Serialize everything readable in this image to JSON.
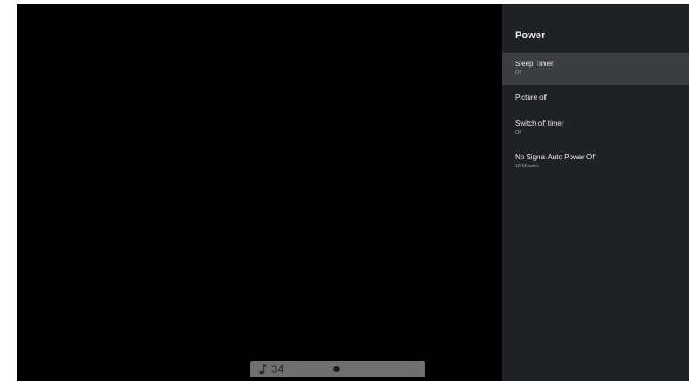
{
  "panel": {
    "title": "Power",
    "items": [
      {
        "label": "Sleep Timer",
        "value": "Off",
        "selected": true
      },
      {
        "label": "Picture off",
        "value": ""
      },
      {
        "label": "Switch off timer",
        "value": "Off"
      },
      {
        "label": "No Signal Auto Power Off",
        "value": "15 Minutes"
      }
    ]
  },
  "volume": {
    "value": "34",
    "level": 0.34,
    "icon": "music-note-icon"
  },
  "colors": {
    "panel_bg": "#202124",
    "selected_bg": "#3c3d41",
    "osd_bg": "#707070",
    "screen_bg": "#000000"
  }
}
